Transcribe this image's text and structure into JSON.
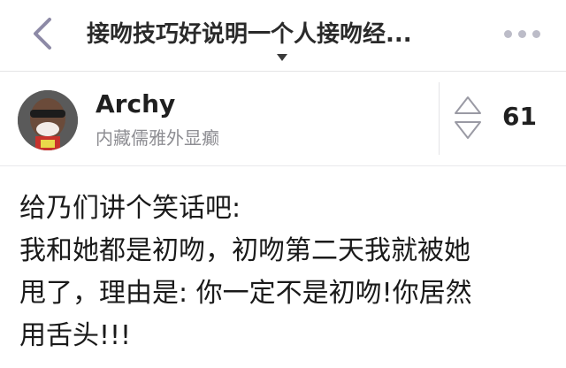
{
  "header": {
    "title": "接吻技巧好说明一个人接吻经...",
    "back_icon": "chevron-left-icon",
    "more_icon": "more-horizontal-icon",
    "title_caret_icon": "caret-down-icon"
  },
  "author": {
    "name": "Archy",
    "bio": "内藏儒雅外显癫"
  },
  "vote": {
    "count": "61"
  },
  "content": {
    "lines": [
      "给乃们讲个笑话吧:",
      "我和她都是初吻，初吻第二天我就被她",
      "甩了，理由是: 你一定不是初吻!你居然",
      "用舌头!!!"
    ]
  },
  "colors": {
    "accent": "#8d8aa6",
    "text": "#1a1a1a",
    "muted": "#8e8e93"
  }
}
